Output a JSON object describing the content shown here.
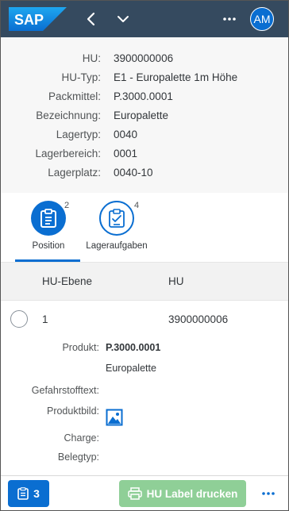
{
  "shell": {
    "logo_text": "SAP",
    "avatar_initials": "AM",
    "brand_color": "#354a5f",
    "accent_color": "#0a6ed1"
  },
  "header": {
    "rows": [
      {
        "label": "HU:",
        "value": "3900000006"
      },
      {
        "label": "HU-Typ:",
        "value": "E1 - Europalette 1m Höhe"
      },
      {
        "label": "Packmittel:",
        "value": "P.3000.0001"
      },
      {
        "label": "Bezeichnung:",
        "value": "Europalette"
      },
      {
        "label": "Lagertyp:",
        "value": "0040"
      },
      {
        "label": "Lagerbereich:",
        "value": "0001"
      },
      {
        "label": "Lagerplatz:",
        "value": "0040-10"
      }
    ]
  },
  "tabs": [
    {
      "label": "Position",
      "count": "2",
      "icon": "clipboard-list-icon",
      "selected": true
    },
    {
      "label": "Lageraufgaben",
      "count": "4",
      "icon": "clipboard-check-icon",
      "selected": false
    }
  ],
  "table": {
    "columns": [
      "HU-Ebene",
      "HU"
    ],
    "rows": [
      {
        "level": "1",
        "hu": "3900000006"
      }
    ]
  },
  "details": {
    "produkt_label": "Produkt:",
    "produkt_value": "P.3000.0001",
    "produkt_desc": "Europalette",
    "gefahr_label": "Gefahrstofftext:",
    "bild_label": "Produktbild:",
    "charge_label": "Charge:",
    "belegtyp_label": "Belegtyp:"
  },
  "footer": {
    "count": "3",
    "print_label": "HU Label drucken"
  }
}
